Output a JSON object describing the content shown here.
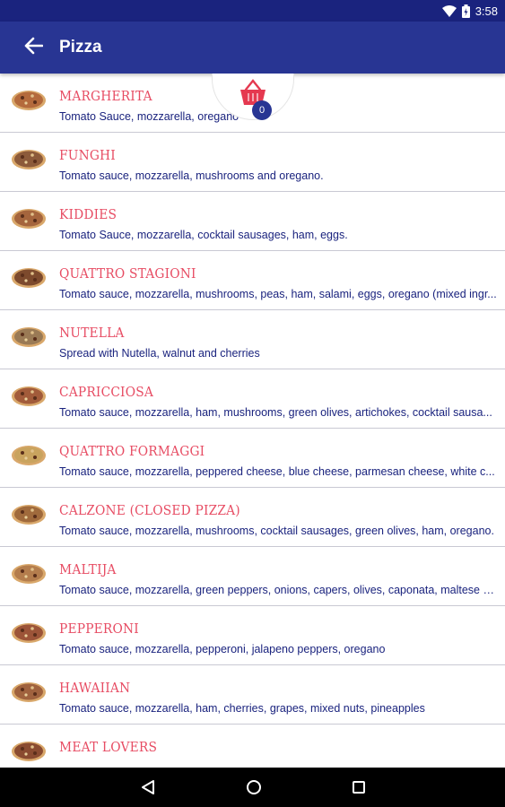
{
  "status_bar": {
    "time": "3:58",
    "icons": [
      "wifi-icon",
      "battery-icon"
    ]
  },
  "app_bar": {
    "title": "Pizza",
    "back_icon": "arrow-left-icon"
  },
  "cart": {
    "count": "0",
    "icon": "basket-icon"
  },
  "items": [
    {
      "name": "MARGHERITA",
      "description": "Tomato Sauce, mozzarella, oregano"
    },
    {
      "name": "FUNGHI",
      "description": "Tomato sauce, mozzarella, mushrooms and oregano."
    },
    {
      "name": "KIDDIES",
      "description": "Tomato Sauce, mozzarella, cocktail sausages, ham, eggs."
    },
    {
      "name": "QUATTRO STAGIONI",
      "description": "Tomato sauce, mozzarella, mushrooms, peas, ham, salami, eggs, oregano (mixed ingr..."
    },
    {
      "name": "NUTELLA",
      "description": "Spread with Nutella, walnut and cherries"
    },
    {
      "name": "CAPRICCIOSA",
      "description": "Tomato sauce, mozzarella, ham, mushrooms, green olives, artichokes, cocktail sausa..."
    },
    {
      "name": "QUATTRO FORMAGGI",
      "description": "Tomato sauce, mozzarella, peppered cheese, blue cheese, parmesan cheese, white c..."
    },
    {
      "name": "CALZONE (CLOSED PIZZA)",
      "description": "Tomato sauce, mozzarella, mushrooms, cocktail sausages, green olives, ham, oregano."
    },
    {
      "name": "MALTIJA",
      "description": "Tomato sauce, mozzarella, green peppers, onions, capers, olives, caponata, maltese s..."
    },
    {
      "name": "PEPPERONI",
      "description": "Tomato sauce, mozzarella, pepperoni, jalapeno peppers, oregano"
    },
    {
      "name": "HAWAIIAN",
      "description": "Tomato sauce, mozzarella, ham, cherries, grapes, mixed nuts, pineapples"
    },
    {
      "name": "MEAT LOVERS",
      "description": ""
    }
  ],
  "nav_bar": {
    "icons": [
      "back-triangle-icon",
      "home-circle-icon",
      "recents-square-icon"
    ]
  },
  "colors": {
    "primary": "#283593",
    "status": "#1a237e",
    "accent": "#e74c63",
    "text": "#1a237e"
  }
}
